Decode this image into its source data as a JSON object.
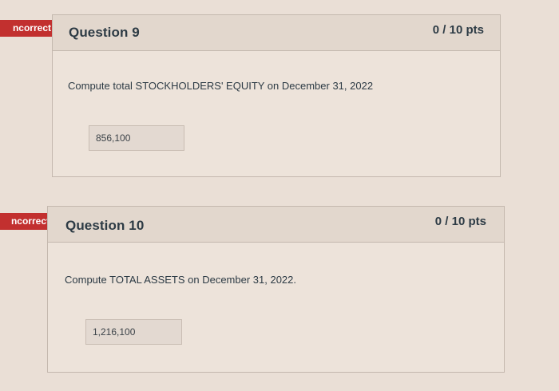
{
  "questions": [
    {
      "status": "Incorrect",
      "status_visible": "ncorrect",
      "title": "Question 9",
      "points": "0 / 10 pts",
      "prompt": "Compute total STOCKHOLDERS' EQUITY on December 31, 2022",
      "answer": "856,100"
    },
    {
      "status": "Incorrect",
      "status_visible": "ncorrect",
      "title": "Question 10",
      "points": "0 / 10 pts",
      "prompt": "Compute TOTAL ASSETS on December 31, 2022.",
      "answer": "1,216,100"
    }
  ],
  "colors": {
    "badge": "#c2302f",
    "background": "#eadfd6",
    "text": "#2d3b45"
  }
}
